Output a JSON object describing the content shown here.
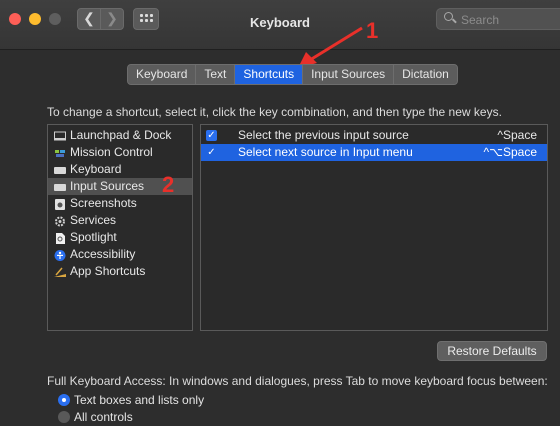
{
  "window": {
    "title": "Keyboard"
  },
  "toolbar": {
    "back_glyph": "❮",
    "forward_glyph": "❯",
    "search_placeholder": "Search"
  },
  "tabs": [
    {
      "label": "Keyboard",
      "active": false
    },
    {
      "label": "Text",
      "active": false
    },
    {
      "label": "Shortcuts",
      "active": true
    },
    {
      "label": "Input Sources",
      "active": false
    },
    {
      "label": "Dictation",
      "active": false
    }
  ],
  "instruction": "To change a shortcut, select it, click the key combination, and then type the new keys.",
  "categories": [
    {
      "label": "Launchpad & Dock",
      "icon": "launchpad-dock-icon",
      "selected": false
    },
    {
      "label": "Mission Control",
      "icon": "mission-control-icon",
      "selected": false
    },
    {
      "label": "Keyboard",
      "icon": "keyboard-icon",
      "selected": false
    },
    {
      "label": "Input Sources",
      "icon": "input-sources-icon",
      "selected": true
    },
    {
      "label": "Screenshots",
      "icon": "screenshots-icon",
      "selected": false
    },
    {
      "label": "Services",
      "icon": "services-gear-icon",
      "selected": false
    },
    {
      "label": "Spotlight",
      "icon": "spotlight-icon",
      "selected": false
    },
    {
      "label": "Accessibility",
      "icon": "accessibility-icon",
      "selected": false
    },
    {
      "label": "App Shortcuts",
      "icon": "app-shortcuts-icon",
      "selected": false
    }
  ],
  "shortcuts": [
    {
      "label": "Select the previous input source",
      "key": "^Space",
      "checked": true,
      "selected": false
    },
    {
      "label": "Select next source in Input menu",
      "key": "^⌥Space",
      "checked": true,
      "selected": true
    }
  ],
  "restore_label": "Restore Defaults",
  "full_keyboard_access": {
    "text": "Full Keyboard Access: In windows and dialogues, press Tab to move keyboard focus between:",
    "options": [
      {
        "label": "Text boxes and lists only",
        "selected": true
      },
      {
        "label": "All controls",
        "selected": false
      }
    ]
  },
  "annotations": {
    "one": "1",
    "two": "2"
  },
  "colors": {
    "accent": "#1f63e0",
    "annotation": "#e8302a"
  }
}
